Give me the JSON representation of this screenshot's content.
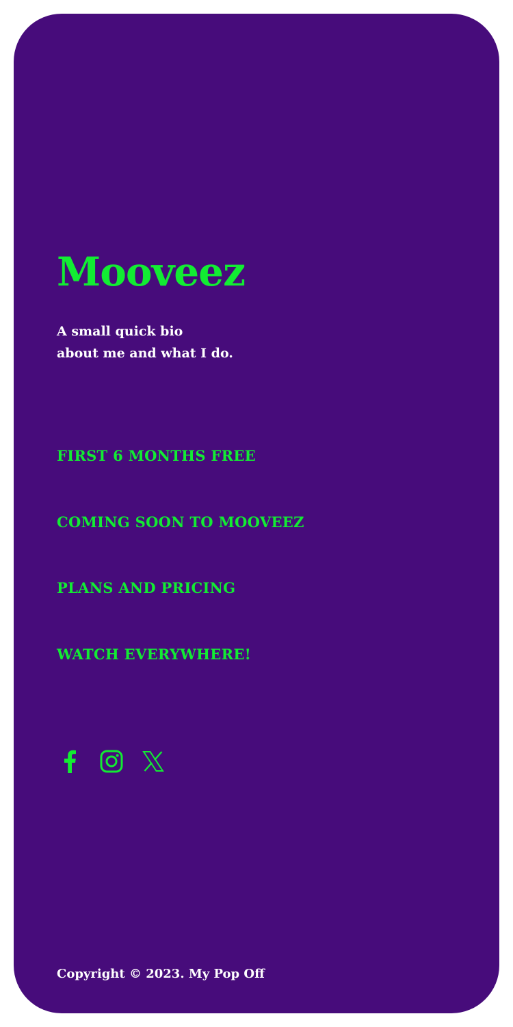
{
  "colors": {
    "page_background": "#ffffff",
    "card_background": "#470c7b",
    "accent": "#12ec33",
    "text": "#ffffff"
  },
  "header": {
    "title": "Mooveez",
    "bio_line_1": "A small quick bio",
    "bio_line_2": "about me and what I do."
  },
  "nav": {
    "items": [
      {
        "label": "FIRST 6 MONTHS FREE"
      },
      {
        "label": "COMING SOON TO MOOVEEZ"
      },
      {
        "label": "PLANS AND PRICING"
      },
      {
        "label": "WATCH EVERYWHERE!"
      }
    ]
  },
  "social": {
    "icons": [
      "facebook-icon",
      "instagram-icon",
      "x-twitter-icon"
    ]
  },
  "footer": {
    "copyright": "Copyright © 2023. My Pop Off"
  }
}
